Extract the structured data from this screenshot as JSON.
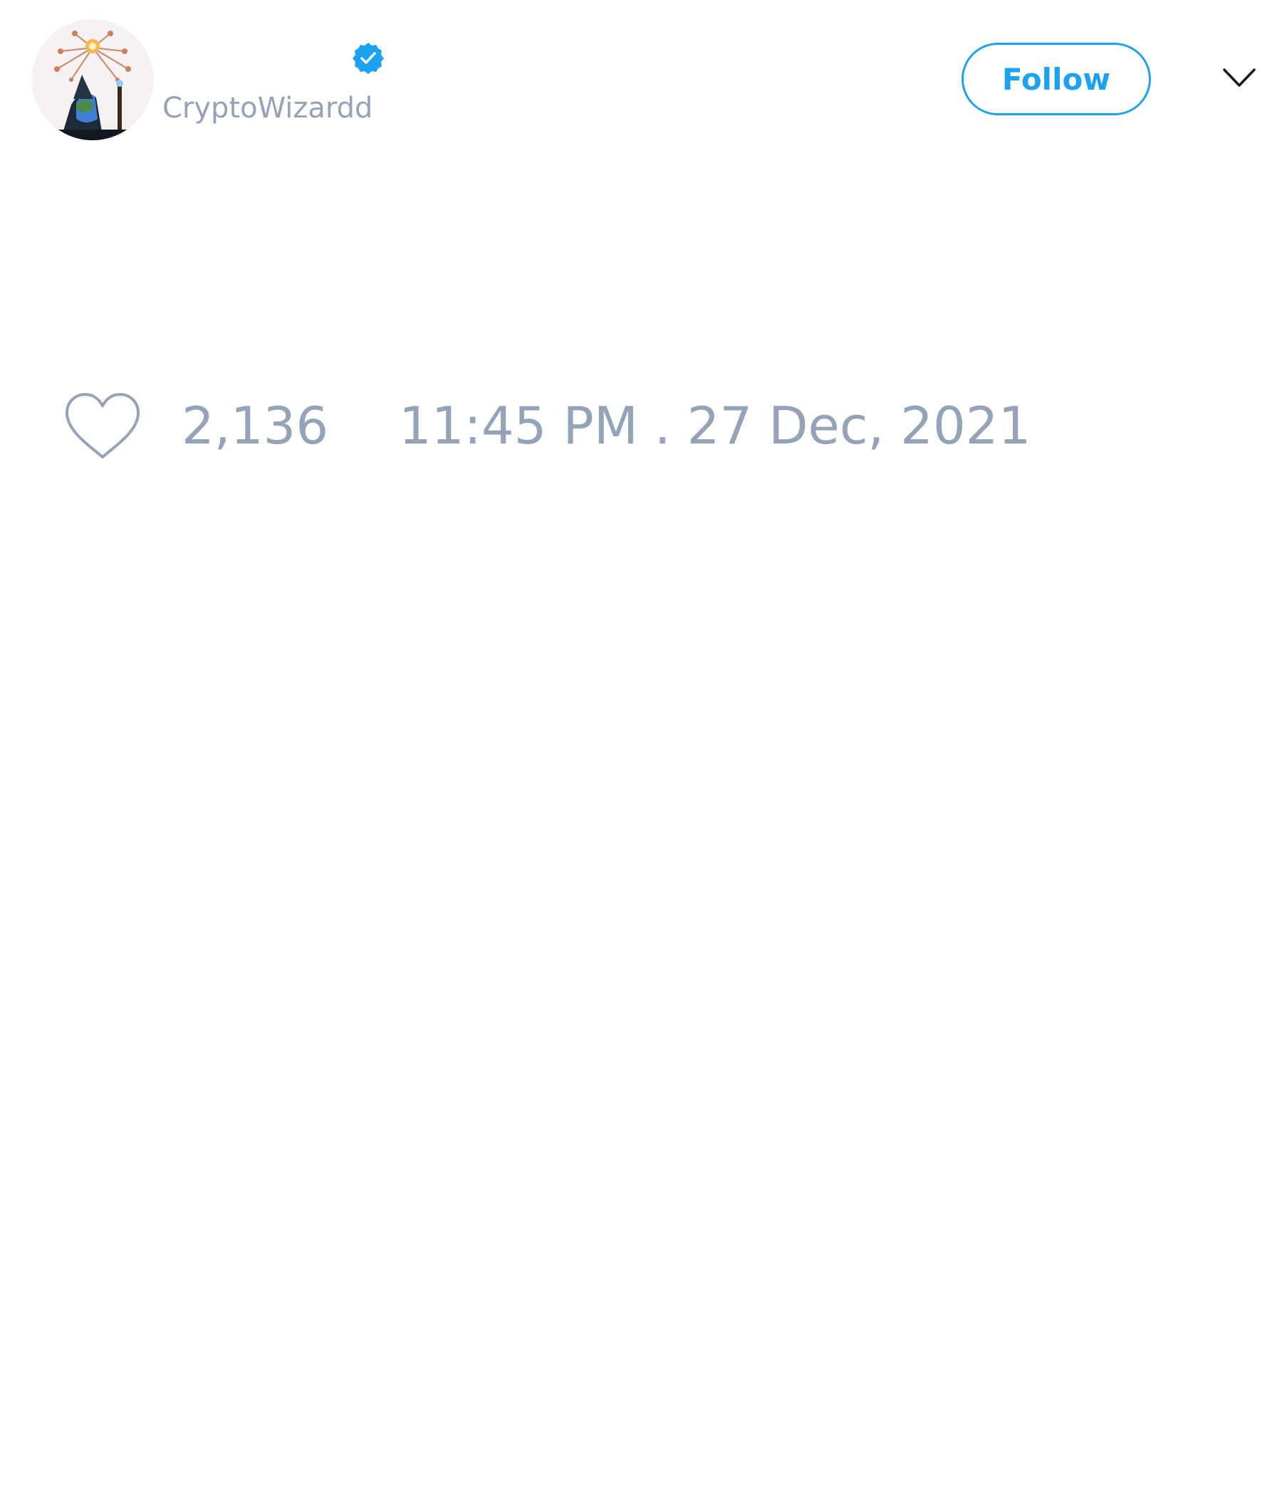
{
  "header": {
    "display_name": "",
    "handle": "CryptoWizardd",
    "verified": true,
    "follow_label": "Follow",
    "avatar_icon": "wizard-avatar",
    "menu_icon": "chevron-down-icon"
  },
  "footer": {
    "like_icon": "heart-outline-icon",
    "like_count": "2,136",
    "timestamp": "11:45 PM . 27 Dec, 2021"
  },
  "colors": {
    "accent": "#1da1f2",
    "muted_text": "#94a3b8",
    "background": "#ffffff"
  }
}
